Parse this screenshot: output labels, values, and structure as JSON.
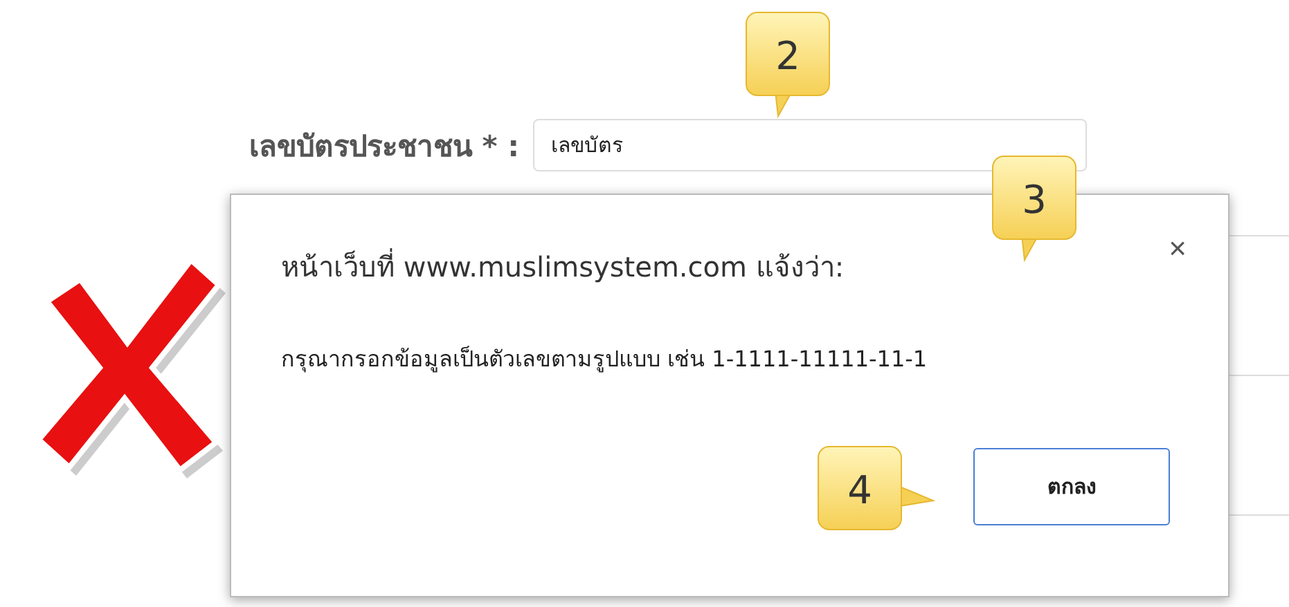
{
  "form": {
    "label": "เลขบัตรประชาชน * :",
    "value": "เลขบัตร"
  },
  "dialog": {
    "title": "หน้าเว็บที่ www.muslimsystem.com แจ้งว่า:",
    "close": "×",
    "message": "กรุณากรอกข้อมูลเป็นตัวเลขตามรูปแบบ เช่น 1-1111-11111-11-1",
    "button": "ตกลง"
  },
  "callouts": [
    {
      "text": "2",
      "kind": "down"
    },
    {
      "text": "3",
      "kind": "down"
    },
    {
      "text": "4",
      "kind": "right"
    }
  ]
}
